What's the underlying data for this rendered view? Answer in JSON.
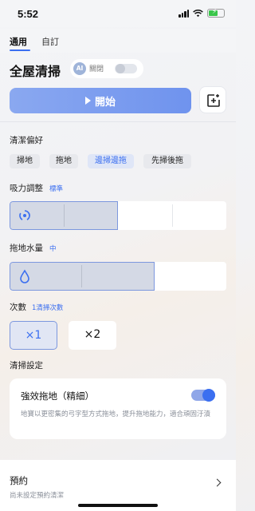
{
  "status": {
    "time": "5:52"
  },
  "tabs": {
    "general": "通用",
    "custom": "自訂"
  },
  "title": "全屋清掃",
  "ai": {
    "badge": "AI",
    "label": "關閉",
    "enabled": false
  },
  "start_button": "開始",
  "icons": {
    "add": "add-square-icon",
    "suction": "swirl-icon",
    "water": "water-drop-icon",
    "chevron": "chevron-right-icon"
  },
  "preference": {
    "label": "清潔偏好",
    "options": [
      "掃地",
      "拖地",
      "邊掃邊拖",
      "先掃後拖"
    ],
    "selected": "邊掃邊拖"
  },
  "suction": {
    "label": "吸力調整",
    "value": "標準",
    "level_fraction": 0.5
  },
  "water": {
    "label": "拖地水量",
    "value": "中",
    "level_fraction": 0.67
  },
  "times": {
    "label": "次數",
    "value": "1清掃次數",
    "options": [
      "×1",
      "×2"
    ],
    "selected": "×1"
  },
  "clean_settings": {
    "label": "清掃設定",
    "intense_mop": {
      "title": "強效拖地（精細）",
      "desc": "地寶以更密集的弓字型方式拖地，提升拖地能力，適合頑固汙漬",
      "enabled": true
    }
  },
  "schedule": {
    "title": "預約",
    "subtitle": "尚未設定預約清潔"
  },
  "colors": {
    "accent": "#3b6ff0",
    "button": "#7a9cef"
  }
}
